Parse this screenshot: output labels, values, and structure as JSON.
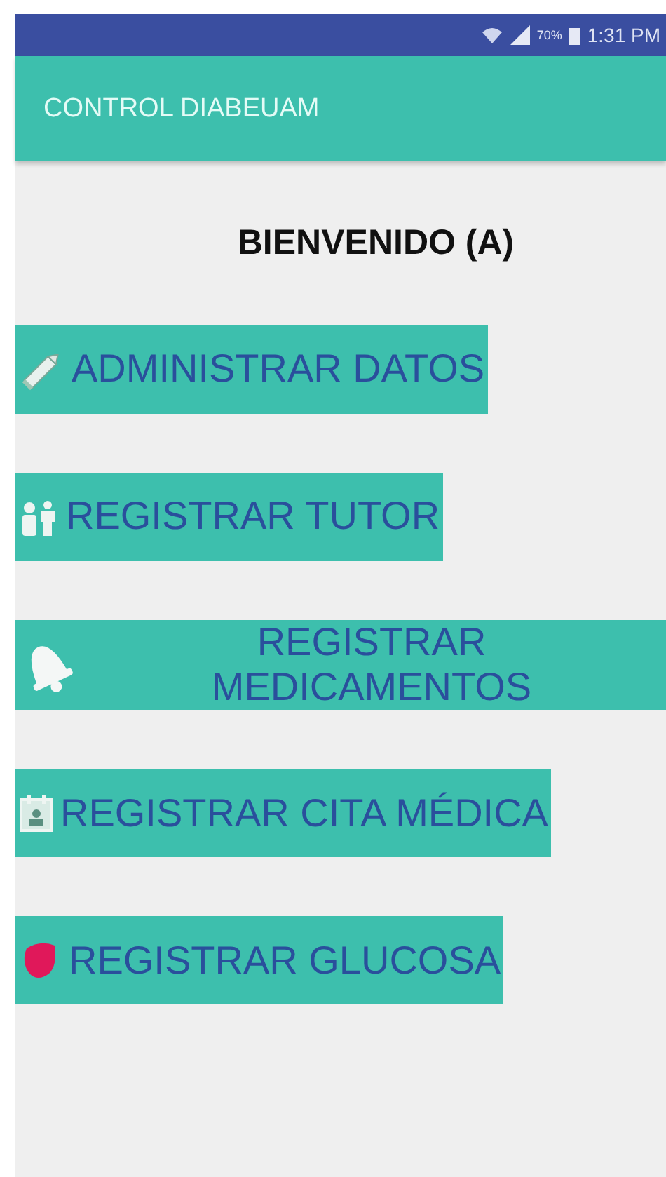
{
  "status_bar": {
    "battery": "70%",
    "time": "1:31 PM"
  },
  "app_bar": {
    "title": "CONTROL DIABEUAM"
  },
  "greeting": "BIENVENIDO (A)",
  "buttons": [
    {
      "kind": "pencil",
      "lines": [
        "ADMINISTRAR DATOS"
      ]
    },
    {
      "kind": "family",
      "lines": [
        "REGISTRAR TUTOR"
      ]
    },
    {
      "kind": "bell",
      "lines": [
        "REGISTRAR",
        "MEDICAMENTOS"
      ]
    },
    {
      "kind": "calendar",
      "lines": [
        "REGISTRAR CITA MÉDICA"
      ]
    },
    {
      "kind": "drop",
      "lines": [
        "REGISTRAR GLUCOSA"
      ]
    }
  ]
}
